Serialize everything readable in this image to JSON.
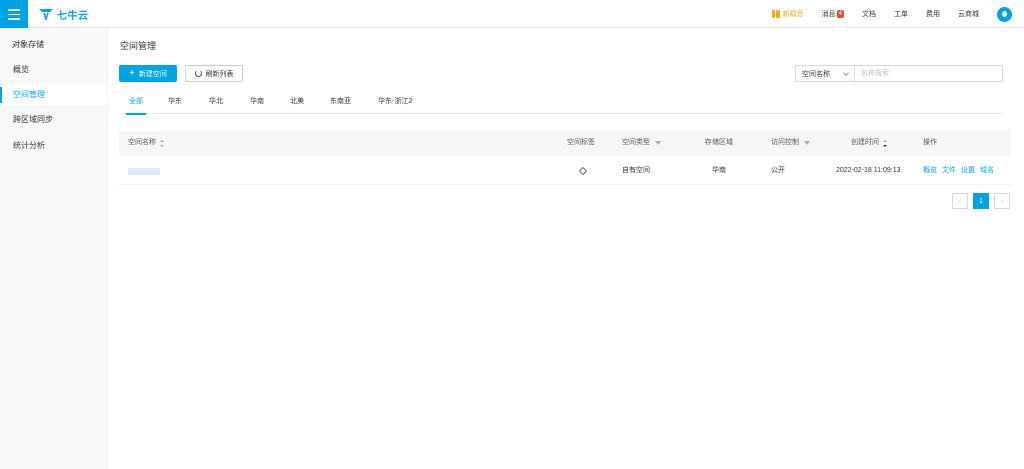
{
  "header": {
    "logo_text": "七牛云",
    "nav": {
      "promo": "新福音",
      "messages": "消息",
      "messages_badge": "4",
      "docs": "文档",
      "tickets": "工单",
      "billing": "费用",
      "mall": "云商城"
    }
  },
  "sidebar": {
    "title": "对象存储",
    "items": [
      {
        "label": "概览"
      },
      {
        "label": "空间管理"
      },
      {
        "label": "跨区域同步"
      },
      {
        "label": "统计分析"
      }
    ]
  },
  "main": {
    "title": "空间管理",
    "new_button": "新建空间",
    "refresh_button": "刷新列表",
    "search": {
      "field": "空间名称",
      "placeholder": "名称搜索"
    },
    "tabs": [
      "全部",
      "华东",
      "华北",
      "华南",
      "北美",
      "东南亚",
      "华东-浙江2"
    ],
    "active_tab": "全部",
    "table": {
      "headers": {
        "name": "空间名称",
        "tags": "空间标签",
        "type": "空间类型",
        "region": "存储区域",
        "access": "访问控制",
        "created": "创建时间",
        "actions": "操作"
      },
      "rows": [
        {
          "type": "自有空间",
          "region": "华南",
          "access": "公开",
          "created": "2022-02-18 11:09:13",
          "actions": [
            "概览",
            "文件",
            "设置",
            "域名"
          ]
        }
      ]
    },
    "pagination": {
      "prev": "‹",
      "current": "1",
      "next": "›"
    }
  },
  "colors": {
    "accent": "#00a4e4",
    "promo": "#f5a623",
    "badge": "#e84c3d"
  }
}
